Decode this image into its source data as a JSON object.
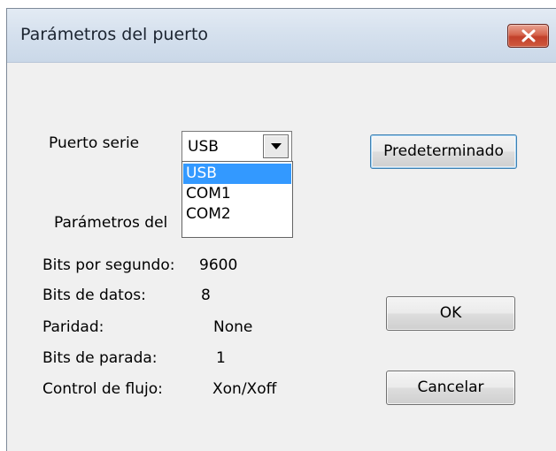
{
  "window": {
    "title": "Parámetros del puerto"
  },
  "port": {
    "label": "Puerto serie",
    "selected": "USB",
    "options": [
      "USB",
      "COM1",
      "COM2"
    ]
  },
  "params": {
    "heading": "Parámetros del",
    "rows": [
      {
        "label": "Bits por segundo:",
        "value": "9600"
      },
      {
        "label": "Bits de datos:",
        "value": "8"
      },
      {
        "label": "Paridad:",
        "value": "None"
      },
      {
        "label": "Bits de parada:",
        "value": "1"
      },
      {
        "label": "Control de flujo:",
        "value": "Xon/Xoff"
      }
    ]
  },
  "buttons": {
    "default_label": "Predeterminado",
    "ok_label": "OK",
    "cancel_label": "Cancelar"
  },
  "icons": {
    "close": "close-icon",
    "dropdown": "chevron-down-icon"
  },
  "colors": {
    "selection": "#3399ff",
    "close_button": "#c94a32",
    "titlebar": "#d6e1ee",
    "dialog_bg": "#f0f0f0"
  }
}
